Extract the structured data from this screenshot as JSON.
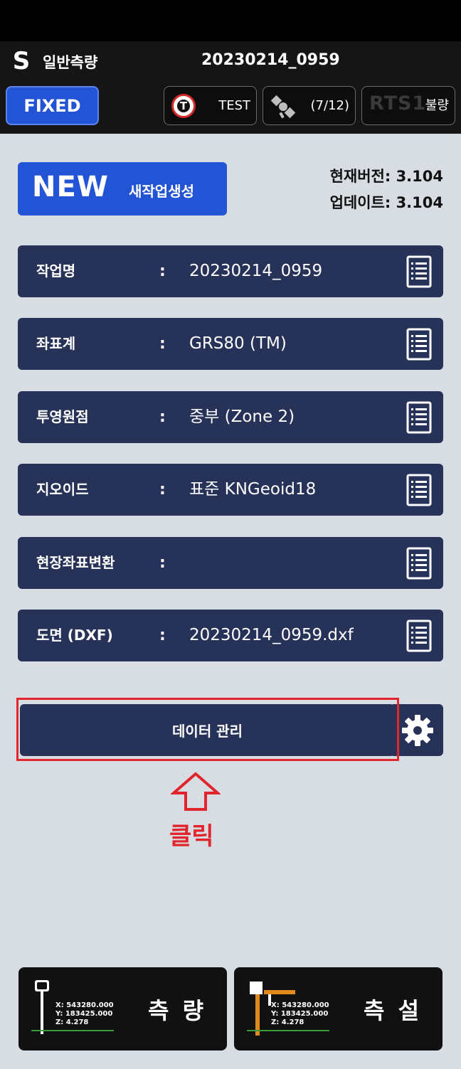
{
  "appbar": {
    "logo": "S",
    "mode": "일반측량",
    "job_name": "20230214_0959",
    "fixed_label": "FIXED",
    "test_label": "TEST",
    "t_logo": "T",
    "satellites": "(7/12)",
    "rts_label": "RTS1",
    "rts_status": "불량"
  },
  "new_button": {
    "big": "NEW",
    "small": "새작업생성"
  },
  "version": {
    "current": "현재버전: 3.104",
    "update": "업데이트: 3.104"
  },
  "rows": [
    {
      "label": "작업명",
      "colon": ":",
      "value": "20230214_0959"
    },
    {
      "label": "좌표계",
      "colon": ":",
      "value": "GRS80 (TM)"
    },
    {
      "label": "투영원점",
      "colon": ":",
      "value": "중부 (Zone 2)"
    },
    {
      "label": "지오이드",
      "colon": ":",
      "value": "표준 KNGeoid18"
    },
    {
      "label": "현장좌표변환",
      "colon": ":",
      "value": ""
    },
    {
      "label": "도면 (DXF)",
      "colon": ":",
      "value": "20230214_0959.dxf"
    }
  ],
  "data_button": "데이터 관리",
  "annotation": {
    "click": "클릭"
  },
  "bottom": {
    "survey_label": "측 량",
    "stakeout_label": "측 설",
    "coord_x": "X: 543280.000",
    "coord_y": "Y: 183425.000",
    "coord_z": "Z: 4.278"
  },
  "colors": {
    "accent_blue": "#2354d6",
    "row_navy": "#273258",
    "highlight_red": "#e2262d"
  }
}
